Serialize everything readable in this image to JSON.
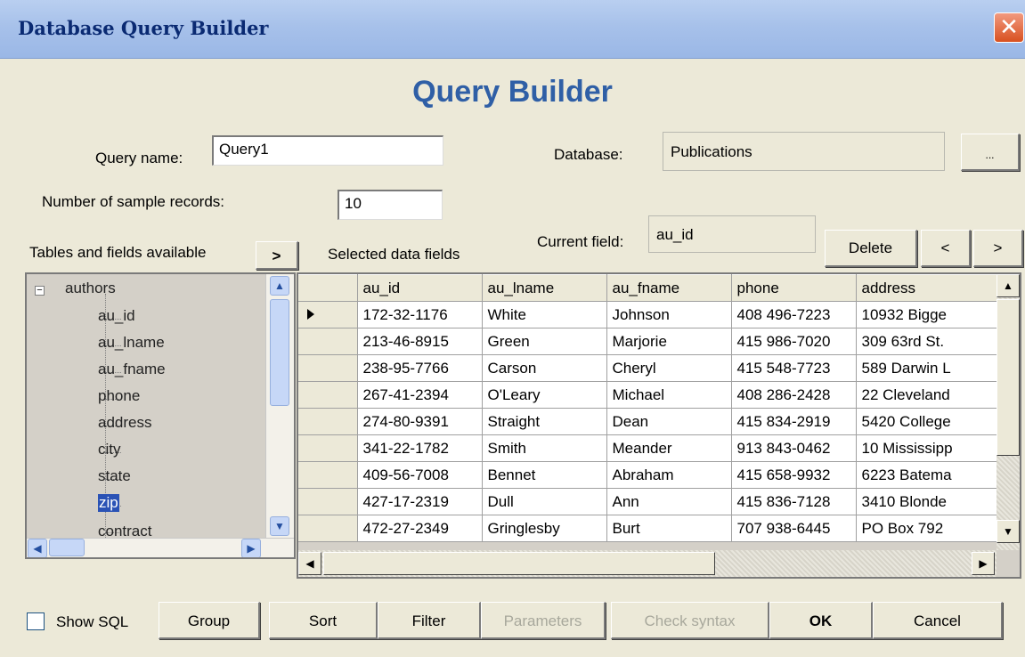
{
  "window": {
    "title": "Database Query Builder"
  },
  "heading": "Query Builder",
  "query_name": {
    "label": "Query name:",
    "value": "Query1"
  },
  "database": {
    "label": "Database:",
    "value": "Publications",
    "browse_label": "..."
  },
  "sample_records": {
    "label": "Number of sample records:",
    "value": "10"
  },
  "tables_label": "Tables and fields available",
  "add_field_label": ">",
  "selected_fields_label": "Selected data fields",
  "current_field": {
    "label": "Current field:",
    "value": "au_id"
  },
  "field_buttons": {
    "delete": "Delete",
    "prev": "<",
    "next": ">"
  },
  "tree": {
    "table": "authors",
    "fields": [
      "au_id",
      "au_lname",
      "au_fname",
      "phone",
      "address",
      "city",
      "state",
      "zip",
      "contract"
    ],
    "selected_field": "zip"
  },
  "grid": {
    "columns": [
      "au_id",
      "au_lname",
      "au_fname",
      "phone",
      "address"
    ],
    "rows": [
      [
        "172-32-1176",
        "White",
        "Johnson",
        "408 496-7223",
        "10932 Bigge"
      ],
      [
        "213-46-8915",
        "Green",
        "Marjorie",
        "415 986-7020",
        "309 63rd St."
      ],
      [
        "238-95-7766",
        "Carson",
        "Cheryl",
        "415 548-7723",
        "589 Darwin L"
      ],
      [
        "267-41-2394",
        "O'Leary",
        "Michael",
        "408 286-2428",
        "22 Cleveland"
      ],
      [
        "274-80-9391",
        "Straight",
        "Dean",
        "415 834-2919",
        "5420 College"
      ],
      [
        "341-22-1782",
        "Smith",
        "Meander",
        "913 843-0462",
        "10 Mississipp"
      ],
      [
        "409-56-7008",
        "Bennet",
        "Abraham",
        "415 658-9932",
        "6223 Batema"
      ],
      [
        "427-17-2319",
        "Dull",
        "Ann",
        "415 836-7128",
        "3410 Blonde"
      ],
      [
        "472-27-2349",
        "Gringlesby",
        "Burt",
        "707 938-6445",
        "PO Box 792"
      ]
    ],
    "current_row": 0
  },
  "footer": {
    "show_sql": "Show SQL",
    "group": "Group",
    "sort": "Sort",
    "filter": "Filter",
    "parameters": "Parameters",
    "check_syntax": "Check syntax",
    "ok": "OK",
    "cancel": "Cancel"
  }
}
